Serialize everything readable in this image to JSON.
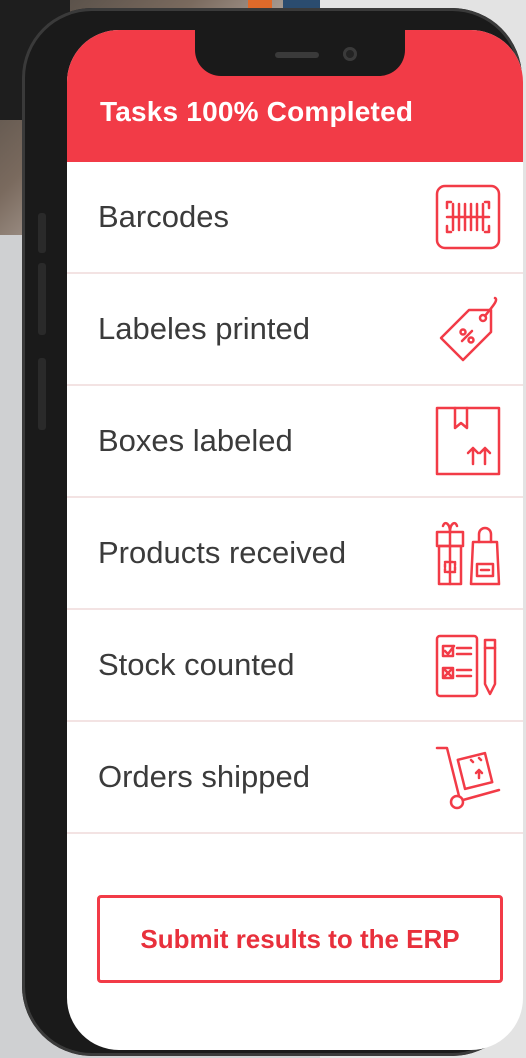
{
  "header": {
    "title": "Tasks 100% Completed"
  },
  "tasks": [
    {
      "label": "Barcodes",
      "icon": "barcode-scan-icon"
    },
    {
      "label": "Labeles printed",
      "icon": "price-tag-icon"
    },
    {
      "label": "Boxes labeled",
      "icon": "box-label-icon"
    },
    {
      "label": "Products received",
      "icon": "packages-icon"
    },
    {
      "label": "Stock counted",
      "icon": "checklist-icon"
    },
    {
      "label": "Orders shipped",
      "icon": "hand-truck-icon"
    }
  ],
  "submit": {
    "label": "Submit results to the ERP"
  },
  "colors": {
    "accent": "#f23b47",
    "text": "#3b3b3b",
    "divider": "#f3e3e3"
  }
}
